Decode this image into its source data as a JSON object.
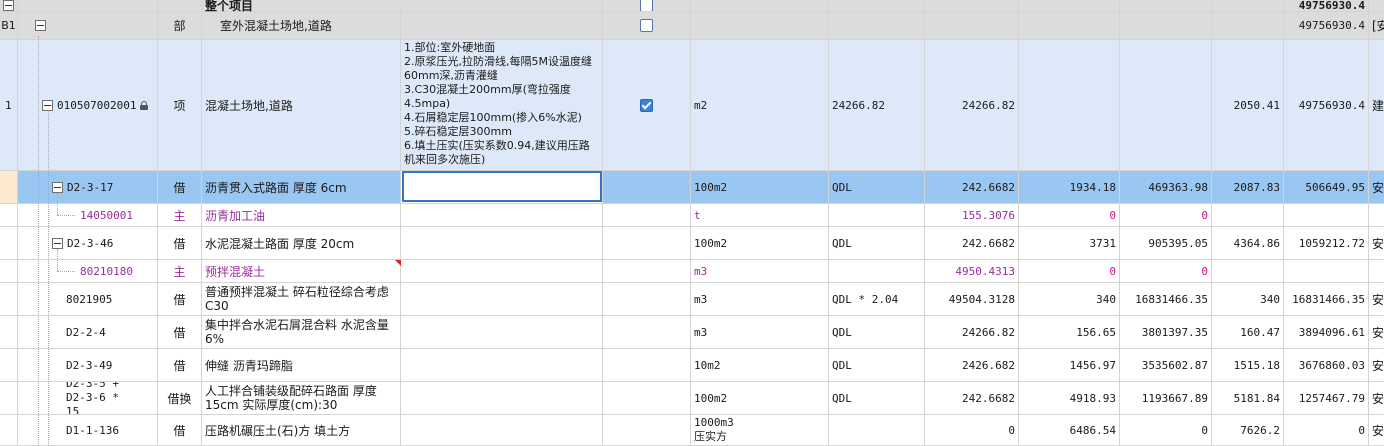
{
  "root": {
    "label": "整个项目",
    "total": "49756930.4"
  },
  "division": {
    "seq": "B1",
    "type": "部",
    "name": "室外混凝土场地,道路",
    "total": "49756930.4",
    "tail": "[安"
  },
  "item": {
    "seq": "1",
    "code": "010507002001",
    "type": "项",
    "name": "混凝土场地,道路",
    "features": [
      "1.部位:室外硬地面",
      "2.原浆压光,拉防滑线,每隔5M设温度缝60mm深,沥青灌缝",
      "3.C30混凝土200mm厚(弯拉强度4.5mpa)",
      "4.石屑稳定层100mm(掺入6%水泥)",
      "5.碎石稳定层300mm",
      "6.填土压实(压实系数0.94,建议用压路机来回多次施压)"
    ],
    "unit": "m2",
    "expr": "24266.82",
    "qty": "24266.82",
    "price": "2050.41",
    "total": "49756930.4",
    "tail": "建"
  },
  "rows": [
    {
      "code": "D2-3-17",
      "type": "借",
      "name": "沥青贯入式路面 厚度 6cm",
      "unit": "100m2",
      "expr": "QDL",
      "qty": "242.6682",
      "p1": "1934.18",
      "t1": "469363.98",
      "p2": "2087.83",
      "t2": "506649.95",
      "tail": "安"
    },
    {
      "code": "14050001",
      "type": "主",
      "name": "沥青加工油",
      "unit": "t",
      "expr": "",
      "qty": "155.3076",
      "p1": "0",
      "t1": "0",
      "p2": "",
      "t2": "",
      "tail": ""
    },
    {
      "code": "D2-3-46",
      "type": "借",
      "name": "水泥混凝土路面 厚度 20cm",
      "unit": "100m2",
      "expr": "QDL",
      "qty": "242.6682",
      "p1": "3731",
      "t1": "905395.05",
      "p2": "4364.86",
      "t2": "1059212.72",
      "tail": "安"
    },
    {
      "code": "80210180",
      "type": "主",
      "name": "预拌混凝土",
      "unit": "m3",
      "expr": "",
      "qty": "4950.4313",
      "p1": "0",
      "t1": "0",
      "p2": "",
      "t2": "",
      "tail": ""
    },
    {
      "code": "8021905",
      "type": "借",
      "name": "普通预拌混凝土 碎石粒径综合考虑 C30",
      "unit": "m3",
      "expr": "QDL * 2.04",
      "qty": "49504.3128",
      "p1": "340",
      "t1": "16831466.35",
      "p2": "340",
      "t2": "16831466.35",
      "tail": "安"
    },
    {
      "code": "D2-2-4",
      "type": "借",
      "name": "集中拌合水泥石屑混合料 水泥含量 6%",
      "unit": "m3",
      "expr": "QDL",
      "qty": "24266.82",
      "p1": "156.65",
      "t1": "3801397.35",
      "p2": "160.47",
      "t2": "3894096.61",
      "tail": "安"
    },
    {
      "code": "D2-3-49",
      "type": "借",
      "name": "伸缝 沥青玛蹄脂",
      "unit": "10m2",
      "expr": "QDL",
      "qty": "2426.682",
      "p1": "1456.97",
      "t1": "3535602.87",
      "p2": "1515.18",
      "t2": "3676860.03",
      "tail": "安"
    },
    {
      "code": "D2-3-5 + D2-3-6 * 15",
      "type": "借换",
      "name": "人工拌合铺装级配碎石路面 厚度 15cm 实际厚度(cm):30",
      "unit": "100m2",
      "expr": "QDL",
      "qty": "242.6682",
      "p1": "4918.93",
      "t1": "1193667.89",
      "p2": "5181.84",
      "t2": "1257467.79",
      "tail": "安"
    },
    {
      "code": "D1-1-136",
      "type": "借",
      "name": "压路机碾压土(石)方 填土方",
      "unit": "1000m3压实方",
      "expr": "",
      "qty": "0",
      "p1": "6486.54",
      "t1": "0",
      "p2": "7626.2",
      "t2": "0",
      "tail": "安"
    }
  ]
}
